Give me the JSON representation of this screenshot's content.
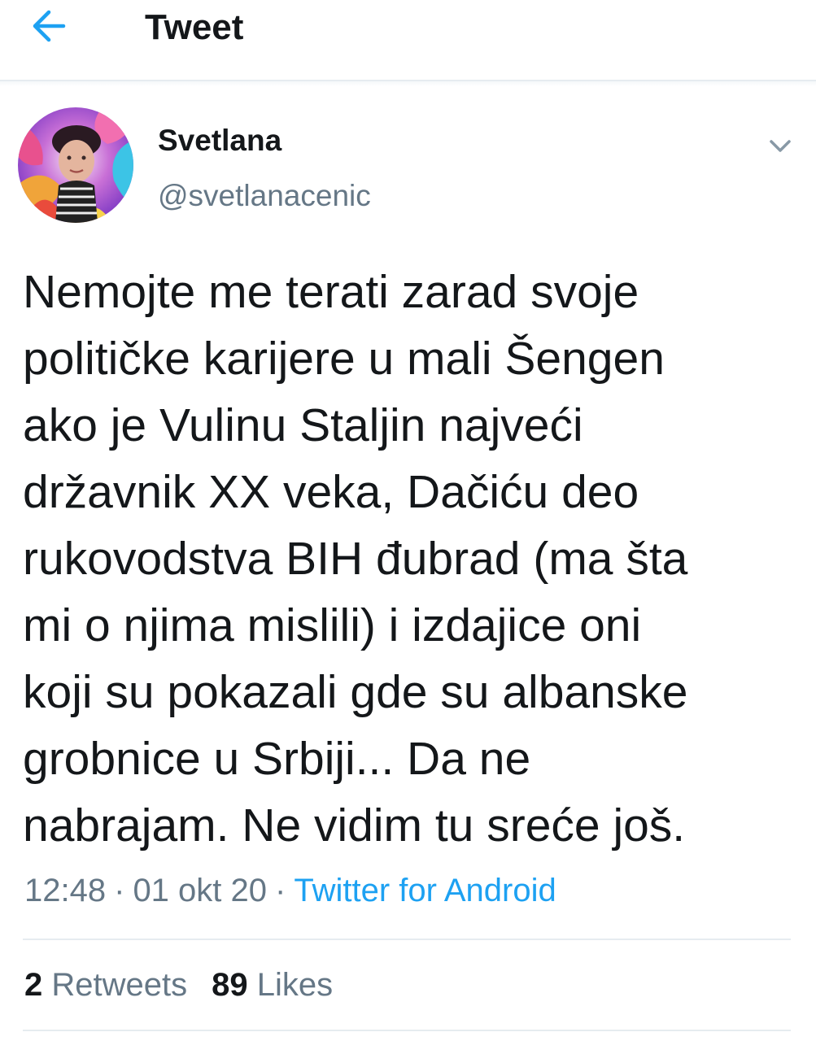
{
  "header": {
    "title": "Tweet",
    "back_icon": "arrow-left-icon",
    "accent_color": "#1da1f2"
  },
  "author": {
    "name": "Svetlana",
    "handle": "@svetlanacenic",
    "more_icon": "chevron-down-icon"
  },
  "tweet": {
    "text": "Nemojte me terati zarad svoje\npolitičke karijere u mali Šengen\nako je Vulinu Staljin najveći\ndržavnik XX veka, Dačiću deo\nrukovodstva BIH đubrad (ma šta\nmi o njima mislili) i izdajice oni\nkoji su pokazali gde su albanske\ngrobnice u Srbiji... Da ne\nnabrajam. Ne vidim tu sreće još.",
    "time": "12:48",
    "date": "01 okt 20",
    "separator": "·",
    "source": "Twitter for Android"
  },
  "stats": {
    "retweets_count": "2",
    "retweets_label": "Retweets",
    "likes_count": "89",
    "likes_label": "Likes"
  }
}
